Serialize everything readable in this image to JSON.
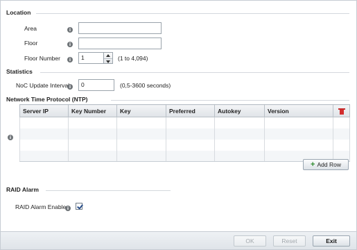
{
  "location": {
    "section_title": "Location",
    "area_label": "Area",
    "area_value": "",
    "floor_label": "Floor",
    "floor_value": "",
    "floor_number_label": "Floor Number",
    "floor_number_value": "1",
    "floor_number_hint": "(1 to 4,094)"
  },
  "statistics": {
    "section_title": "Statistics",
    "noc_label": "NoC Update Interval",
    "noc_value": "0",
    "noc_hint": "(0,5-3600 seconds)"
  },
  "ntp": {
    "section_title": "Network Time Protocol (NTP)",
    "columns": [
      "Server IP",
      "Key Number",
      "Key",
      "Preferred",
      "Autokey",
      "Version"
    ],
    "add_row_label": "Add Row"
  },
  "raid": {
    "section_title": "RAID Alarm",
    "enable_label": "RAID Alarm Enable",
    "enable_checked": true
  },
  "footer": {
    "ok_label": "OK",
    "reset_label": "Reset",
    "exit_label": "Exit"
  },
  "colors": {
    "accent": "#2a4f8a",
    "delete": "#d32f2f",
    "add": "#2e8b2e"
  }
}
